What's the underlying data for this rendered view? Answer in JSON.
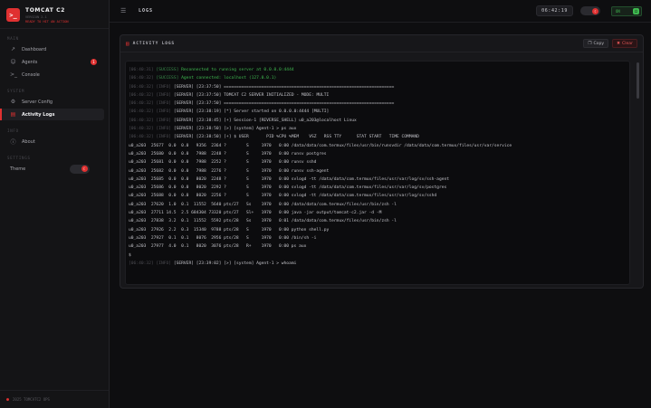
{
  "brand": {
    "name": "TOMCAT C2",
    "version": "VERSION 2.1",
    "status": "READY TO HIT AN ACTION"
  },
  "sidebar": {
    "sections": [
      {
        "title": "MAIN",
        "items": [
          {
            "label": "Dashboard",
            "icon": "chart-icon"
          },
          {
            "label": "Agents",
            "icon": "users-icon",
            "badge": "1"
          },
          {
            "label": "Console",
            "icon": "terminal-icon"
          }
        ]
      },
      {
        "title": "SYSTEM",
        "items": [
          {
            "label": "Server Config",
            "icon": "gear-icon"
          },
          {
            "label": "Activity Logs",
            "icon": "file-icon",
            "active": true
          }
        ]
      },
      {
        "title": "INFO",
        "items": [
          {
            "label": "About",
            "icon": "info-icon"
          }
        ]
      },
      {
        "title": "SETTINGS",
        "items": [
          {
            "label": "Theme",
            "icon": "",
            "toggle": true
          }
        ]
      }
    ],
    "footer": "2025 TOMCATC2 OPS"
  },
  "topbar": {
    "title": "LOGS",
    "clock": "06:42:19",
    "connection_label": "ON"
  },
  "panel": {
    "title": "ACTIVITY LOGS",
    "copy_label": "Copy",
    "clear_label": "Clear"
  },
  "colors": {
    "accent": "#e03131",
    "success": "#3fb950",
    "background": "#0e0e10"
  },
  "logs": [
    {
      "ts": "[06:40:31]",
      "level": "[SUCCESS]",
      "msg": "Reconnected to running server at 0.0.0.0:4444",
      "kind": "success"
    },
    {
      "ts": "[06:40:32]",
      "level": "[SUCCESS]",
      "msg": "Agent connected: localhost (127.0.0.1)",
      "kind": "success"
    },
    {
      "ts": "[06:40:32]",
      "level": "[INFO]",
      "msg": "[SERVER] [23:37:50] ====================================================================",
      "kind": "info"
    },
    {
      "ts": "[06:40:32]",
      "level": "[INFO]",
      "msg": "[SERVER] [23:37:50] TOMCAT C2 SERVER INITIALIZED - MODE: MULTI",
      "kind": "info"
    },
    {
      "ts": "[06:40:32]",
      "level": "[INFO]",
      "msg": "[SERVER] [23:37:50] ====================================================================",
      "kind": "info"
    },
    {
      "ts": "[06:40:32]",
      "level": "[INFO]",
      "msg": "[SERVER] [23:38:19] [*] Server started on 0.0.0.0:4444 [MULTI]",
      "kind": "info"
    },
    {
      "ts": "[06:40:32]",
      "level": "[INFO]",
      "msg": "[SERVER] [23:38:45] [+] Session-1 [REVERSE_SHELL] u0_a203@localhost Linux",
      "kind": "info"
    },
    {
      "ts": "[06:40:32]",
      "level": "[INFO]",
      "msg": "[SERVER] [23:38:50] [>] [system] Agent-1 > ps aux",
      "kind": "info"
    },
    {
      "ts": "[06:40:32]",
      "level": "[INFO]",
      "msg": "[SERVER] [23:38:50] [+] $ USER       PID %CPU %MEM    VSZ   RSS TTY      STAT START   TIME COMMAND",
      "kind": "info"
    },
    {
      "ts": "",
      "level": "",
      "msg": "u0_a203  25677  0.0  0.0   9356  2364 ?        S     1970   0:00 /data/data/com.termux/files/usr/bin/runsvdir /data/data/com.termux/files/usr/var/service",
      "kind": "plain"
    },
    {
      "ts": "",
      "level": "",
      "msg": "u0_a203  25680  0.0  0.0   7988  2248 ?        S     1970   0:00 runsv postgres",
      "kind": "plain"
    },
    {
      "ts": "",
      "level": "",
      "msg": "u0_a203  25681  0.0  0.0   7988  2252 ?        S     1970   0:00 runsv sshd",
      "kind": "plain"
    },
    {
      "ts": "",
      "level": "",
      "msg": "u0_a203  25682  0.0  0.0   7988  2276 ?        S     1970   0:00 runsv ssh-agent",
      "kind": "plain"
    },
    {
      "ts": "",
      "level": "",
      "msg": "u0_a203  25685  0.0  0.0   8020  2248 ?        S     1970   0:00 svlogd -tt /data/data/com.termux/files/usr/var/log/sv/ssh-agent",
      "kind": "plain"
    },
    {
      "ts": "",
      "level": "",
      "msg": "u0_a203  25686  0.0  0.0   8020  2292 ?        S     1970   0:00 svlogd -tt /data/data/com.termux/files/usr/var/log/sv/postgres",
      "kind": "plain"
    },
    {
      "ts": "",
      "level": "",
      "msg": "u0_a203  25688  0.0  0.0   8020  2256 ?        S     1970   0:00 svlogd -tt /data/data/com.termux/files/usr/var/log/sv/sshd",
      "kind": "plain"
    },
    {
      "ts": "",
      "level": "",
      "msg": "u0_a203  27620  1.0  0.1  11552  5640 pts/27   Ss    1970   0:00 /data/data/com.termux/files/usr/bin/zsh -l",
      "kind": "plain"
    },
    {
      "ts": "",
      "level": "",
      "msg": "u0_a203  27711 14.5  2.5 684304 73320 pts/27   Sl+   1970   0:00 java -jar output/tomcat-c2.jar -d -M",
      "kind": "plain"
    },
    {
      "ts": "",
      "level": "",
      "msg": "u0_a203  27838  3.2  0.1  11552  5592 pts/28   Ss    1970   0:01 /data/data/com.termux/files/usr/bin/zsh -l",
      "kind": "plain"
    },
    {
      "ts": "",
      "level": "",
      "msg": "u0_a203  27926  2.2  0.3  15340  9788 pts/28   S     1970   0:00 python shell.py",
      "kind": "plain"
    },
    {
      "ts": "",
      "level": "",
      "msg": "u0_a203  27927  0.1  0.1   8076  2956 pts/28   S     1970   0:00 /bin/sh -i",
      "kind": "plain"
    },
    {
      "ts": "",
      "level": "",
      "msg": "u0_a203  27977  4.0  0.1   8020  3076 pts/28   R+    1970   0:00 ps aux",
      "kind": "plain"
    },
    {
      "ts": "",
      "level": "",
      "msg": "$",
      "kind": "plain"
    },
    {
      "ts": "[06:40:32]",
      "level": "[INFO]",
      "msg": "[SERVER] [23:39:02] [>] [system] Agent-1 > whoami",
      "kind": "info"
    }
  ]
}
